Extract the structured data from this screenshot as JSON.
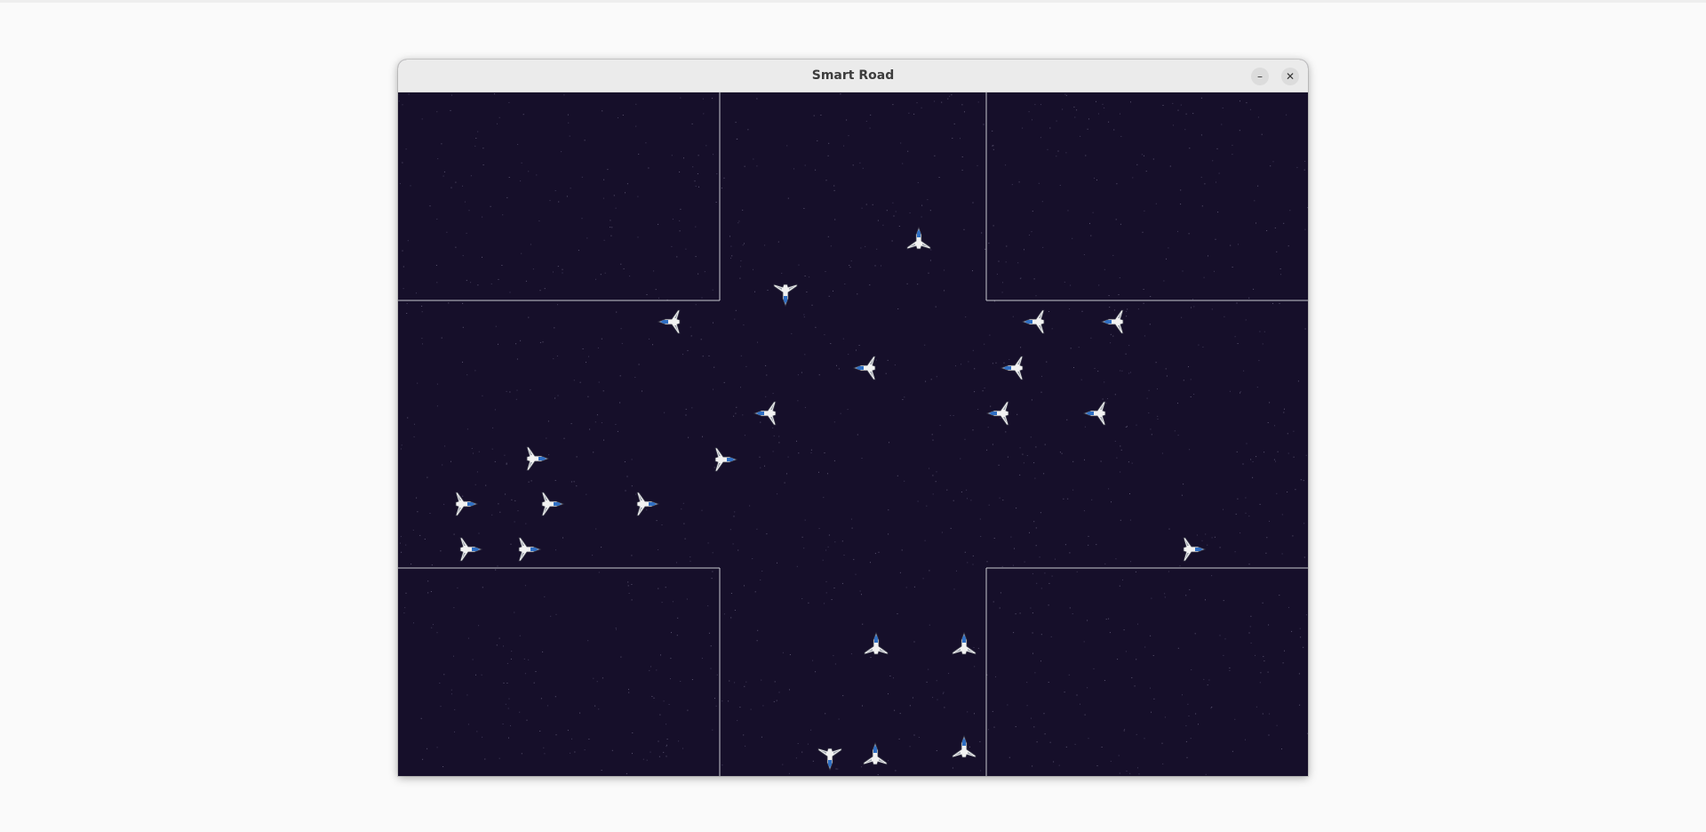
{
  "window": {
    "title": "Smart Road",
    "minimize_glyph": "–",
    "close_glyph": "✕"
  },
  "scene": {
    "background_color": "#160f2a",
    "border_color": "#c8c8d0",
    "icon": "spaceship-vehicle-icon",
    "vehicles": [
      {
        "heading": "north",
        "lane": "northbound-right"
      },
      {
        "heading": "south",
        "lane": "southbound-left"
      },
      {
        "heading": "west",
        "lane": "westbound"
      },
      {
        "heading": "west",
        "lane": "westbound"
      },
      {
        "heading": "west",
        "lane": "westbound"
      },
      {
        "heading": "west",
        "lane": "westbound"
      },
      {
        "heading": "west",
        "lane": "westbound"
      },
      {
        "heading": "west",
        "lane": "westbound"
      },
      {
        "heading": "west",
        "lane": "westbound"
      },
      {
        "heading": "west",
        "lane": "westbound"
      },
      {
        "heading": "east",
        "lane": "eastbound"
      },
      {
        "heading": "east",
        "lane": "eastbound"
      },
      {
        "heading": "east",
        "lane": "eastbound"
      },
      {
        "heading": "east",
        "lane": "eastbound"
      },
      {
        "heading": "east",
        "lane": "eastbound"
      },
      {
        "heading": "east",
        "lane": "eastbound"
      },
      {
        "heading": "east",
        "lane": "eastbound"
      },
      {
        "heading": "east",
        "lane": "eastbound"
      },
      {
        "heading": "north",
        "lane": "northbound"
      },
      {
        "heading": "north",
        "lane": "northbound"
      },
      {
        "heading": "north",
        "lane": "northbound"
      },
      {
        "heading": "north",
        "lane": "northbound"
      },
      {
        "heading": "south",
        "lane": "southbound"
      }
    ]
  }
}
